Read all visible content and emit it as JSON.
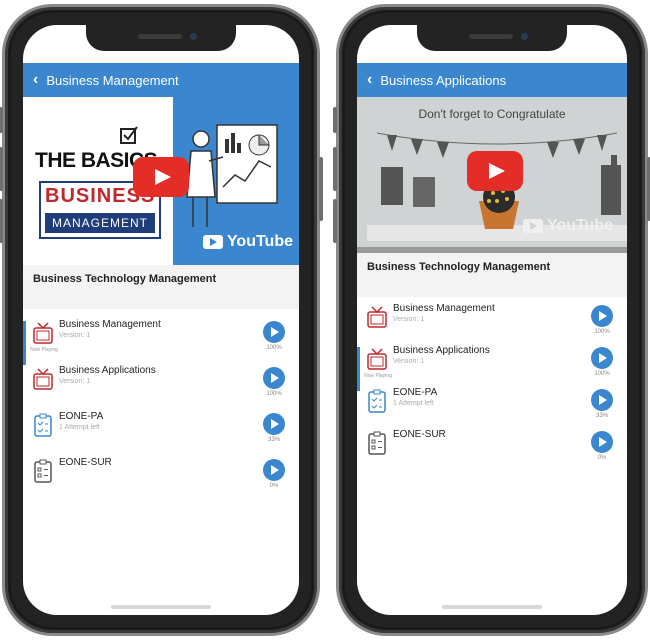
{
  "left": {
    "header_title": "Business Management",
    "video": {
      "line1": "THE BASICS",
      "line2": "BUSINESS",
      "line3": "MANAGEMENT",
      "brand": "YouTube"
    },
    "course_title": "Business Technology Management",
    "items": [
      {
        "name": "Business Management",
        "sub": "Version: 1",
        "status": "Now Playing",
        "progress": "100%",
        "type": "video"
      },
      {
        "name": "Business Applications",
        "sub": "Version: 1",
        "status": "",
        "progress": "100%",
        "type": "video"
      },
      {
        "name": "EONE-PA",
        "sub": "1 Attempt left",
        "status": "",
        "progress": "33%",
        "type": "quiz"
      },
      {
        "name": "EONE-SUR",
        "sub": "",
        "status": "",
        "progress": "0%",
        "type": "survey"
      }
    ]
  },
  "right": {
    "header_title": "Business Applications",
    "video": {
      "caption": "Don't forget to Congratulate",
      "brand": "YouTube"
    },
    "course_title": "Business Technology Management",
    "items": [
      {
        "name": "Business Management",
        "sub": "Version: 1",
        "status": "",
        "progress": "100%",
        "type": "video"
      },
      {
        "name": "Business Applications",
        "sub": "Version: 1",
        "status": "Now Playing",
        "progress": "100%",
        "type": "video"
      },
      {
        "name": "EONE-PA",
        "sub": "1 Attempt left",
        "status": "",
        "progress": "33%",
        "type": "quiz"
      },
      {
        "name": "EONE-SUR",
        "sub": "",
        "status": "",
        "progress": "0%",
        "type": "survey"
      }
    ]
  },
  "colors": {
    "accent": "#3a86cf",
    "youtube_red": "#e52d27"
  }
}
